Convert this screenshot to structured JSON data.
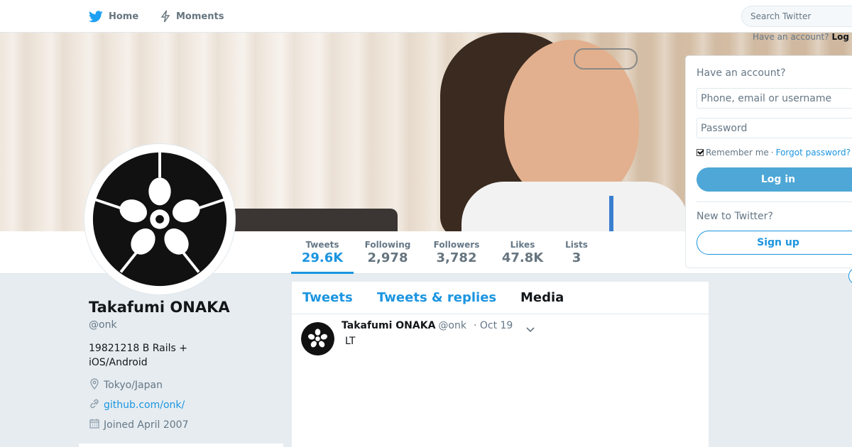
{
  "nav": {
    "home": "Home",
    "moments": "Moments",
    "search_placeholder": "Search Twitter",
    "have_account": "Have an account?",
    "login_link": "Log"
  },
  "profile": {
    "name": "Takafumi ONAKA",
    "handle": "@onk",
    "bio": "19821218 B Rails + iOS/Android",
    "location": "Tokyo/Japan",
    "url": "github.com/onk/",
    "joined": "Joined April 2007"
  },
  "stats": [
    {
      "label": "Tweets",
      "value": "29.6K"
    },
    {
      "label": "Following",
      "value": "2,978"
    },
    {
      "label": "Followers",
      "value": "3,782"
    },
    {
      "label": "Likes",
      "value": "47.8K"
    },
    {
      "label": "Lists",
      "value": "3"
    }
  ],
  "timeline": {
    "tabs": [
      "Tweets",
      "Tweets & replies",
      "Media"
    ],
    "tweet": {
      "name": "Takafumi ONAKA",
      "handle": "@onk",
      "date": "· Oct 19",
      "text": "LT"
    }
  },
  "login": {
    "title": "Have an account?",
    "username_placeholder": "Phone, email or username",
    "password_placeholder": "Password",
    "remember": "Remember me",
    "separator": "·",
    "forgot": "Forgot password?",
    "login_button": "Log in",
    "new_title": "New to Twitter?",
    "signup_button": "Sign up"
  },
  "colors": {
    "accent": "#1b95e0",
    "login_button": "#4ea7d6",
    "background": "#e6ecf0"
  },
  "icons": {
    "home": "twitter-bird-icon",
    "moments": "lightning-icon",
    "location": "location-pin-icon",
    "url": "link-icon",
    "joined": "calendar-icon",
    "caret": "chevron-down-icon"
  }
}
